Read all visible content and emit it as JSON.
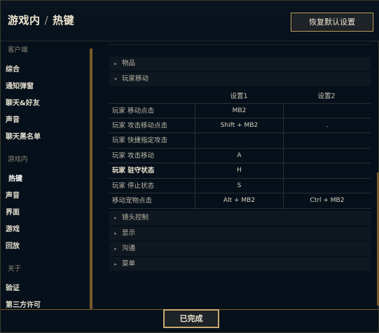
{
  "header": {
    "title_left": "游戏内",
    "title_sep": "/",
    "title_right": "热键",
    "restore_label": "恢复默认设置"
  },
  "sidebar": {
    "client_group": "客户端",
    "client_items": [
      "综合",
      "通知弹窗",
      "聊天&好友",
      "声音",
      "聊天黑名单"
    ],
    "ingame_group": "游戏内",
    "ingame_items": [
      "热键",
      "声音",
      "界面",
      "游戏",
      "回放"
    ],
    "about_group": "关于",
    "about_items": [
      "验证",
      "第三方许可"
    ],
    "active": "热键"
  },
  "sections": {
    "items": "物品",
    "movement": "玩家移动",
    "camera": "镜头控制",
    "display": "显示",
    "communication": "沟通",
    "menu": "菜单"
  },
  "columns": {
    "setting1": "设置1",
    "setting2": "设置2"
  },
  "rows": [
    {
      "name": "玩家 移动点击",
      "key1": "MB2",
      "key2": ""
    },
    {
      "name": "玩家 攻击移动点击",
      "key1": "Shift + MB2",
      "key2": "."
    },
    {
      "name": "玩家 快捷指定攻击",
      "key1": "",
      "key2": ""
    },
    {
      "name": "玩家 攻击移动",
      "key1": "A",
      "key2": ""
    },
    {
      "name": "玩家 驻守状态",
      "key1": "H",
      "key2": ""
    },
    {
      "name": "玩家 停止状态",
      "key1": "S",
      "key2": ""
    },
    {
      "name": "移动宠物点击",
      "key1": "Alt + MB2",
      "key2": "Ctrl + MB2"
    }
  ],
  "footer": {
    "done_label": "已完成"
  },
  "icons": {
    "collapsed": "chevron-right-icon",
    "expanded": "chevron-down-icon"
  }
}
